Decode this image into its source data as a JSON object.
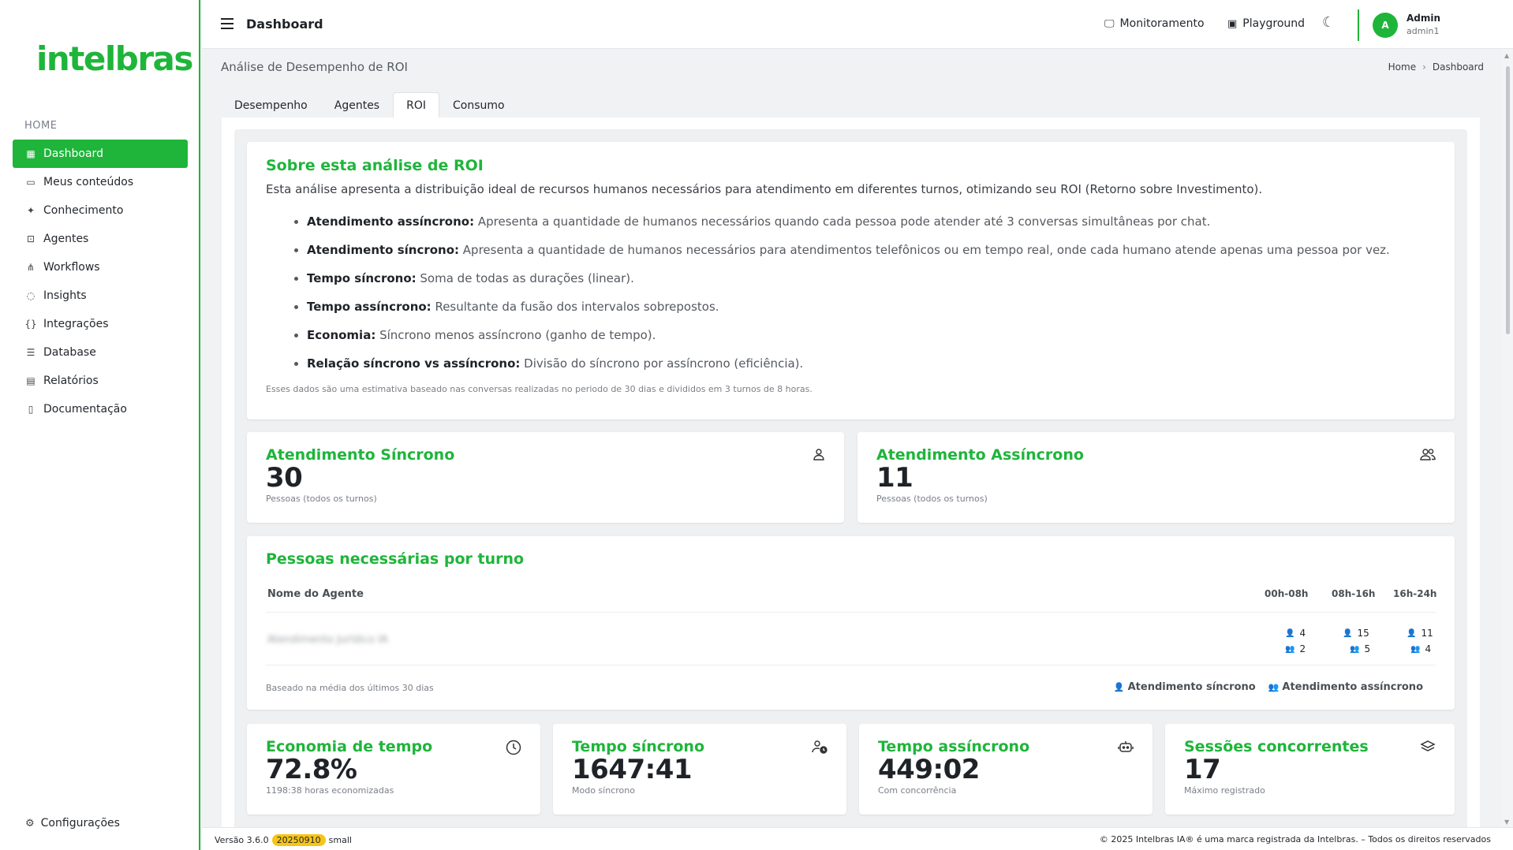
{
  "sidebar": {
    "logo": "intelbras",
    "section": "HOME",
    "items": [
      {
        "label": "Dashboard",
        "icon": "grid-icon",
        "glyph": "▦"
      },
      {
        "label": "Meus conteúdos",
        "icon": "folder-icon",
        "glyph": "▭"
      },
      {
        "label": "Conhecimento",
        "icon": "sparkle-icon",
        "glyph": "✦"
      },
      {
        "label": "Agentes",
        "icon": "robot-icon",
        "glyph": "⊡"
      },
      {
        "label": "Workflows",
        "icon": "workflow-icon",
        "glyph": "⋔"
      },
      {
        "label": "Insights",
        "icon": "lightbulb-icon",
        "glyph": "◌"
      },
      {
        "label": "Integrações",
        "icon": "braces-icon",
        "glyph": "{}"
      },
      {
        "label": "Database",
        "icon": "database-icon",
        "glyph": "☰"
      },
      {
        "label": "Relatórios",
        "icon": "report-icon",
        "glyph": "▤"
      },
      {
        "label": "Documentação",
        "icon": "book-icon",
        "glyph": "▯"
      }
    ],
    "settings_label": "Configurações"
  },
  "topbar": {
    "title": "Dashboard",
    "monitor_label": "Monitoramento",
    "playground_label": "Playground",
    "user_initial": "A",
    "user_name": "Admin",
    "user_login": "admin1"
  },
  "page": {
    "title": "Análise de Desempenho de ROI",
    "breadcrumb": {
      "home": "Home",
      "current": "Dashboard"
    }
  },
  "tabs": [
    "Desempenho",
    "Agentes",
    "ROI",
    "Consumo"
  ],
  "about": {
    "title": "Sobre esta análise de ROI",
    "description": "Esta análise apresenta a distribuição ideal de recursos humanos necessários para atendimento em diferentes turnos, otimizando seu ROI (Retorno sobre Investimento).",
    "items": [
      {
        "term": "Atendimento assíncrono:",
        "text": " Apresenta a quantidade de humanos necessários quando cada pessoa pode atender até 3 conversas simultâneas por chat."
      },
      {
        "term": "Atendimento síncrono:",
        "text": " Apresenta a quantidade de humanos necessários para atendimentos telefônicos ou em tempo real, onde cada humano atende apenas uma pessoa por vez."
      },
      {
        "term": "Tempo síncrono:",
        "text": " Soma de todas as durações (linear)."
      },
      {
        "term": "Tempo assíncrono:",
        "text": " Resultante da fusão dos intervalos sobrepostos."
      },
      {
        "term": "Economia:",
        "text": " Síncrono menos assíncrono (ganho de tempo)."
      },
      {
        "term": "Relação síncrono vs assíncrono:",
        "text": " Divisão do síncrono por assíncrono (eficiência)."
      }
    ],
    "note": "Esses dados são uma estimativa baseado nas conversas realizadas no periodo de 30 dias e divididos em 3 turnos de 8 horas."
  },
  "sync_card": {
    "title": "Atendimento Síncrono",
    "value": "30",
    "sub": "Pessoas (todos os turnos)"
  },
  "async_card": {
    "title": "Atendimento Assíncrono",
    "value": "11",
    "sub": "Pessoas (todos os turnos)"
  },
  "turnos": {
    "title": "Pessoas necessárias por turno",
    "col_name": "Nome do Agente",
    "shifts": [
      "00h-08h",
      "08h-16h",
      "16h-24h"
    ],
    "row": {
      "agent": "Atendimento Jurídico IA",
      "sync": [
        "4",
        "15",
        "11"
      ],
      "async": [
        "2",
        "5",
        "4"
      ]
    },
    "footnote": "Baseado na média dos últimos 30 dias",
    "legend_sync": "Atendimento síncrono",
    "legend_async": "Atendimento assíncrono"
  },
  "metrics": [
    {
      "title": "Economia de tempo",
      "value": "72.8%",
      "sub": "1198:38 horas economizadas",
      "icon": "clock-icon"
    },
    {
      "title": "Tempo síncrono",
      "value": "1647:41",
      "sub": "Modo síncrono",
      "icon": "user-clock-icon"
    },
    {
      "title": "Tempo assíncrono",
      "value": "449:02",
      "sub": "Com concorrência",
      "icon": "bot-icon"
    },
    {
      "title": "Sessões concorrentes",
      "value": "17",
      "sub": "Máximo registrado",
      "icon": "layers-icon"
    }
  ],
  "footer": {
    "version": "Versão 3.6.0",
    "build": "20250910",
    "size": "small",
    "copyright": "© 2025 Intelbras IA® é uma marca registrada da Intelbras. – Todos os direitos reservados"
  },
  "colors": {
    "brand": "#1eb53a",
    "badge": "#f5c518"
  }
}
